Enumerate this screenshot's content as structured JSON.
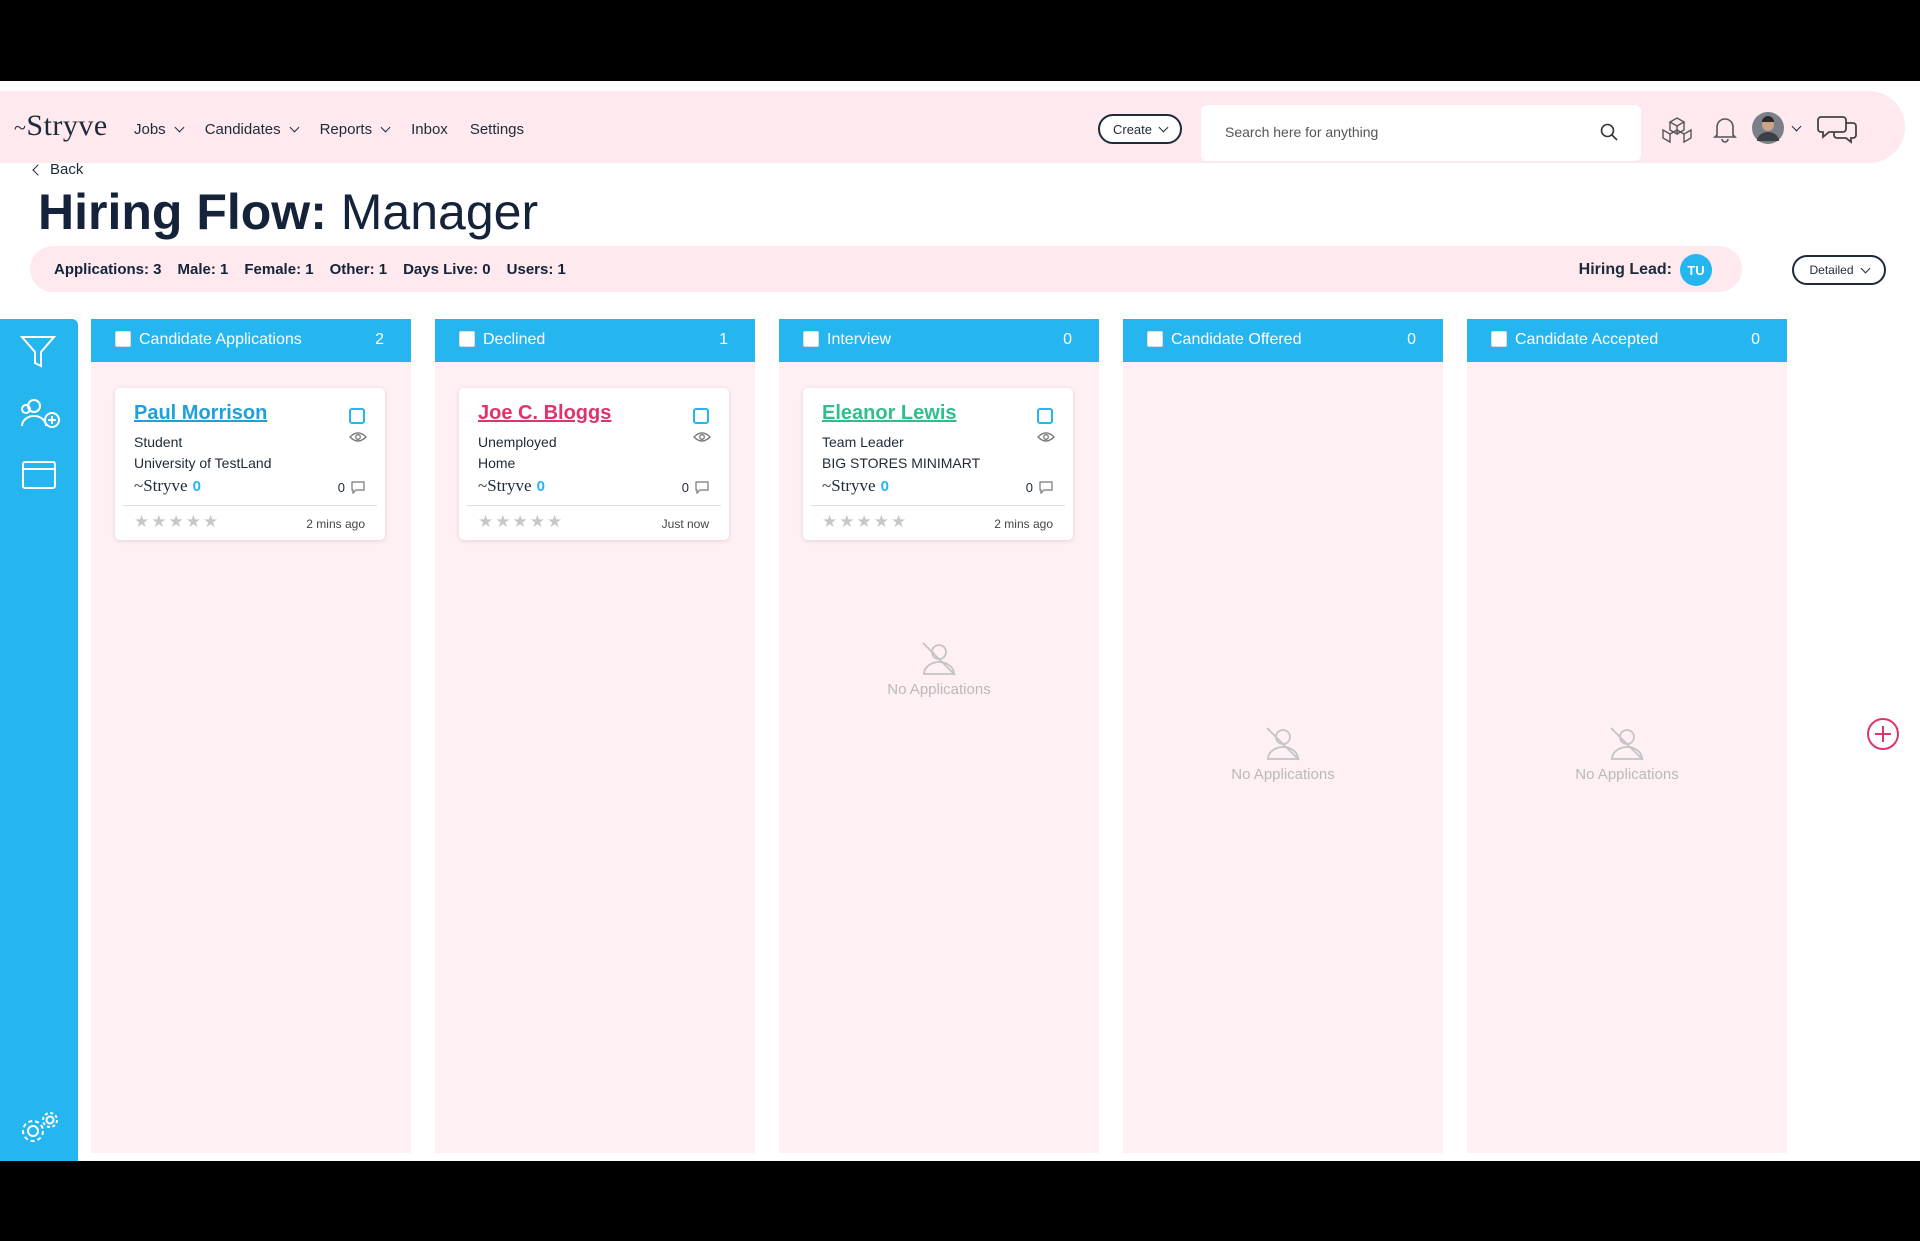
{
  "brand": {
    "logo": "Stryve",
    "accent": "#25b5ef",
    "nav_bg": "#fde9ee"
  },
  "nav": {
    "items": [
      {
        "label": "Jobs",
        "dropdown": true
      },
      {
        "label": "Candidates",
        "dropdown": true
      },
      {
        "label": "Reports",
        "dropdown": true
      },
      {
        "label": "Inbox",
        "dropdown": false
      },
      {
        "label": "Settings",
        "dropdown": false
      }
    ],
    "create_label": "Create",
    "search_placeholder": "Search here for anything",
    "icons": [
      "search-icon",
      "apps-cube-icon",
      "bell-icon",
      "user-avatar",
      "chat-icon"
    ]
  },
  "header": {
    "back_label": "Back",
    "title_prefix": "Hiring Flow:",
    "title_job": "Manager",
    "stats": {
      "applications": "Applications: 3",
      "male": "Male: 1",
      "female": "Female: 1",
      "other": "Other: 1",
      "days_live": "Days Live: 0",
      "users": "Users: 1"
    },
    "hiring_lead_label": "Hiring Lead:",
    "hiring_lead_initials": "TU",
    "view_mode": "Detailed"
  },
  "columns": [
    {
      "name": "Candidate Applications",
      "count": "2",
      "card": {
        "name": "Paul Morrison",
        "name_color": "#1ea0dc",
        "line1": "Student",
        "line2": "University of TestLand",
        "source": "Stryve",
        "score": "0",
        "comments": "0",
        "stars": "★★★★★",
        "time": "2 mins ago"
      }
    },
    {
      "name": "Declined",
      "count": "1",
      "card": {
        "name": "Joe C. Bloggs",
        "name_color": "#e0336b",
        "line1": "Unemployed",
        "line2": "Home",
        "source": "Stryve",
        "score": "0",
        "comments": "0",
        "stars": "★★★★★",
        "time": "Just now"
      }
    },
    {
      "name": "Interview",
      "count": "0",
      "card": {
        "name": "Eleanor Lewis",
        "name_color": "#2ebf8a",
        "line1": "Team Leader",
        "line2": "BIG STORES MINIMART",
        "source": "Stryve",
        "score": "0",
        "comments": "0",
        "stars": "★★★★★",
        "time": "2 mins ago"
      },
      "empty_text": "No Applications"
    },
    {
      "name": "Candidate Offered",
      "count": "0",
      "empty_text": "No Applications"
    },
    {
      "name": "Candidate Accepted",
      "count": "0",
      "empty_text": "No Applications"
    }
  ],
  "sidebar": {
    "icons": [
      "filter-icon",
      "add-users-icon",
      "window-icon",
      "settings-gears-icon"
    ]
  }
}
